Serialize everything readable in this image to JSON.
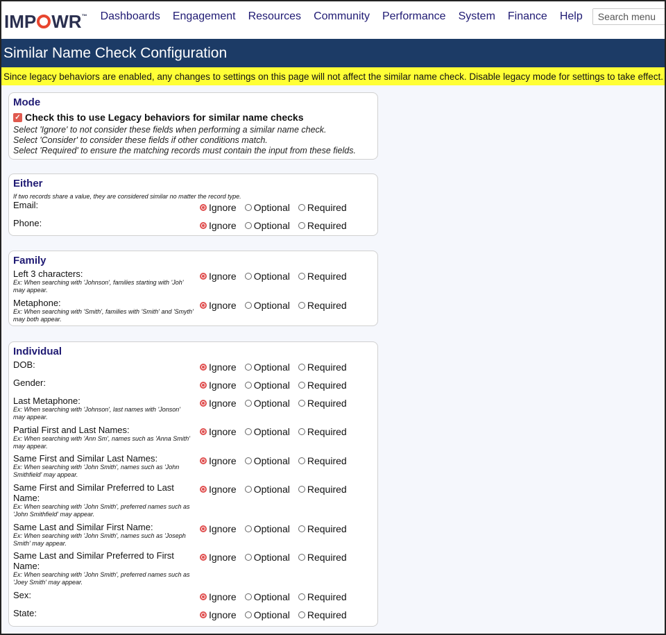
{
  "brand": {
    "logo_text_a": "IMP",
    "logo_text_b": "WR",
    "trademark": "™",
    "accent": "#e8462f",
    "nav_color": "#1f1a73",
    "title_bar_color": "#1c3b66",
    "notice_color": "#ffff36"
  },
  "nav": [
    "Dashboards",
    "Engagement",
    "Resources",
    "Community",
    "Performance",
    "System",
    "Finance",
    "Help"
  ],
  "search": {
    "placeholder": "Search menu",
    "icon": "search-icon"
  },
  "page_title": "Similar Name Check Configuration",
  "notice": "Since legacy behaviors are enabled, any changes to settings on this page will not affect the similar name check. Disable legacy mode for settings to take effect.",
  "options": [
    "Ignore",
    "Optional",
    "Required"
  ],
  "mode": {
    "title": "Mode",
    "legacy_checked": true,
    "legacy_label": "Check this to use Legacy behaviors for similar name checks",
    "help": [
      "Select 'Ignore' to not consider these fields when performing a similar name check.",
      "Select 'Consider' to consider these fields if other conditions match.",
      "Select 'Required' to ensure the matching records must contain the input from these fields."
    ]
  },
  "either": {
    "title": "Either",
    "subtitle": "If two records share a value, they are considered similar no matter the record type.",
    "rows": [
      {
        "label": "Email:",
        "example": "",
        "selected": "Ignore"
      },
      {
        "label": "Phone:",
        "example": "",
        "selected": "Ignore"
      }
    ]
  },
  "family": {
    "title": "Family",
    "rows": [
      {
        "label": "Left 3 characters:",
        "example": "Ex: When searching with 'Johnson', families starting with 'Joh' may appear.",
        "selected": "Ignore"
      },
      {
        "label": "Metaphone:",
        "example": "Ex: When searching with 'Smith', families with 'Smith' and 'Smyth' may both appear.",
        "selected": "Ignore"
      }
    ]
  },
  "individual": {
    "title": "Individual",
    "rows": [
      {
        "label": "DOB:",
        "example": "",
        "selected": "Ignore"
      },
      {
        "label": "Gender:",
        "example": "",
        "selected": "Ignore"
      },
      {
        "label": "Last Metaphone:",
        "example": "Ex: When searching with 'Johnson', last names with 'Jonson' may appear.",
        "selected": "Ignore"
      },
      {
        "label": "Partial First and Last Names:",
        "example": "Ex: When searching with 'Ann Sm', names such as 'Anna Smith' may appear.",
        "selected": "Ignore"
      },
      {
        "label": "Same First and Similar Last Names:",
        "example": "Ex: When searching with 'John Smith', names such as 'John Smithfield' may appear.",
        "selected": "Ignore"
      },
      {
        "label": "Same First and Similar Preferred to Last Name:",
        "example": "Ex: When searching with 'John Smith', preferred names such as 'John Smithfield' may appear.",
        "selected": "Ignore"
      },
      {
        "label": "Same Last and Similar First Name:",
        "example": "Ex: When searching with 'John Smith', names such as 'Joseph Smith' may appear.",
        "selected": "Ignore"
      },
      {
        "label": "Same Last and Similar Preferred to First Name:",
        "example": "Ex: When searching with 'John Smith', preferred names such as 'Joey Smith' may appear.",
        "selected": "Ignore"
      },
      {
        "label": "Sex:",
        "example": "",
        "selected": "Ignore"
      },
      {
        "label": "State:",
        "example": "",
        "selected": "Ignore"
      }
    ]
  }
}
